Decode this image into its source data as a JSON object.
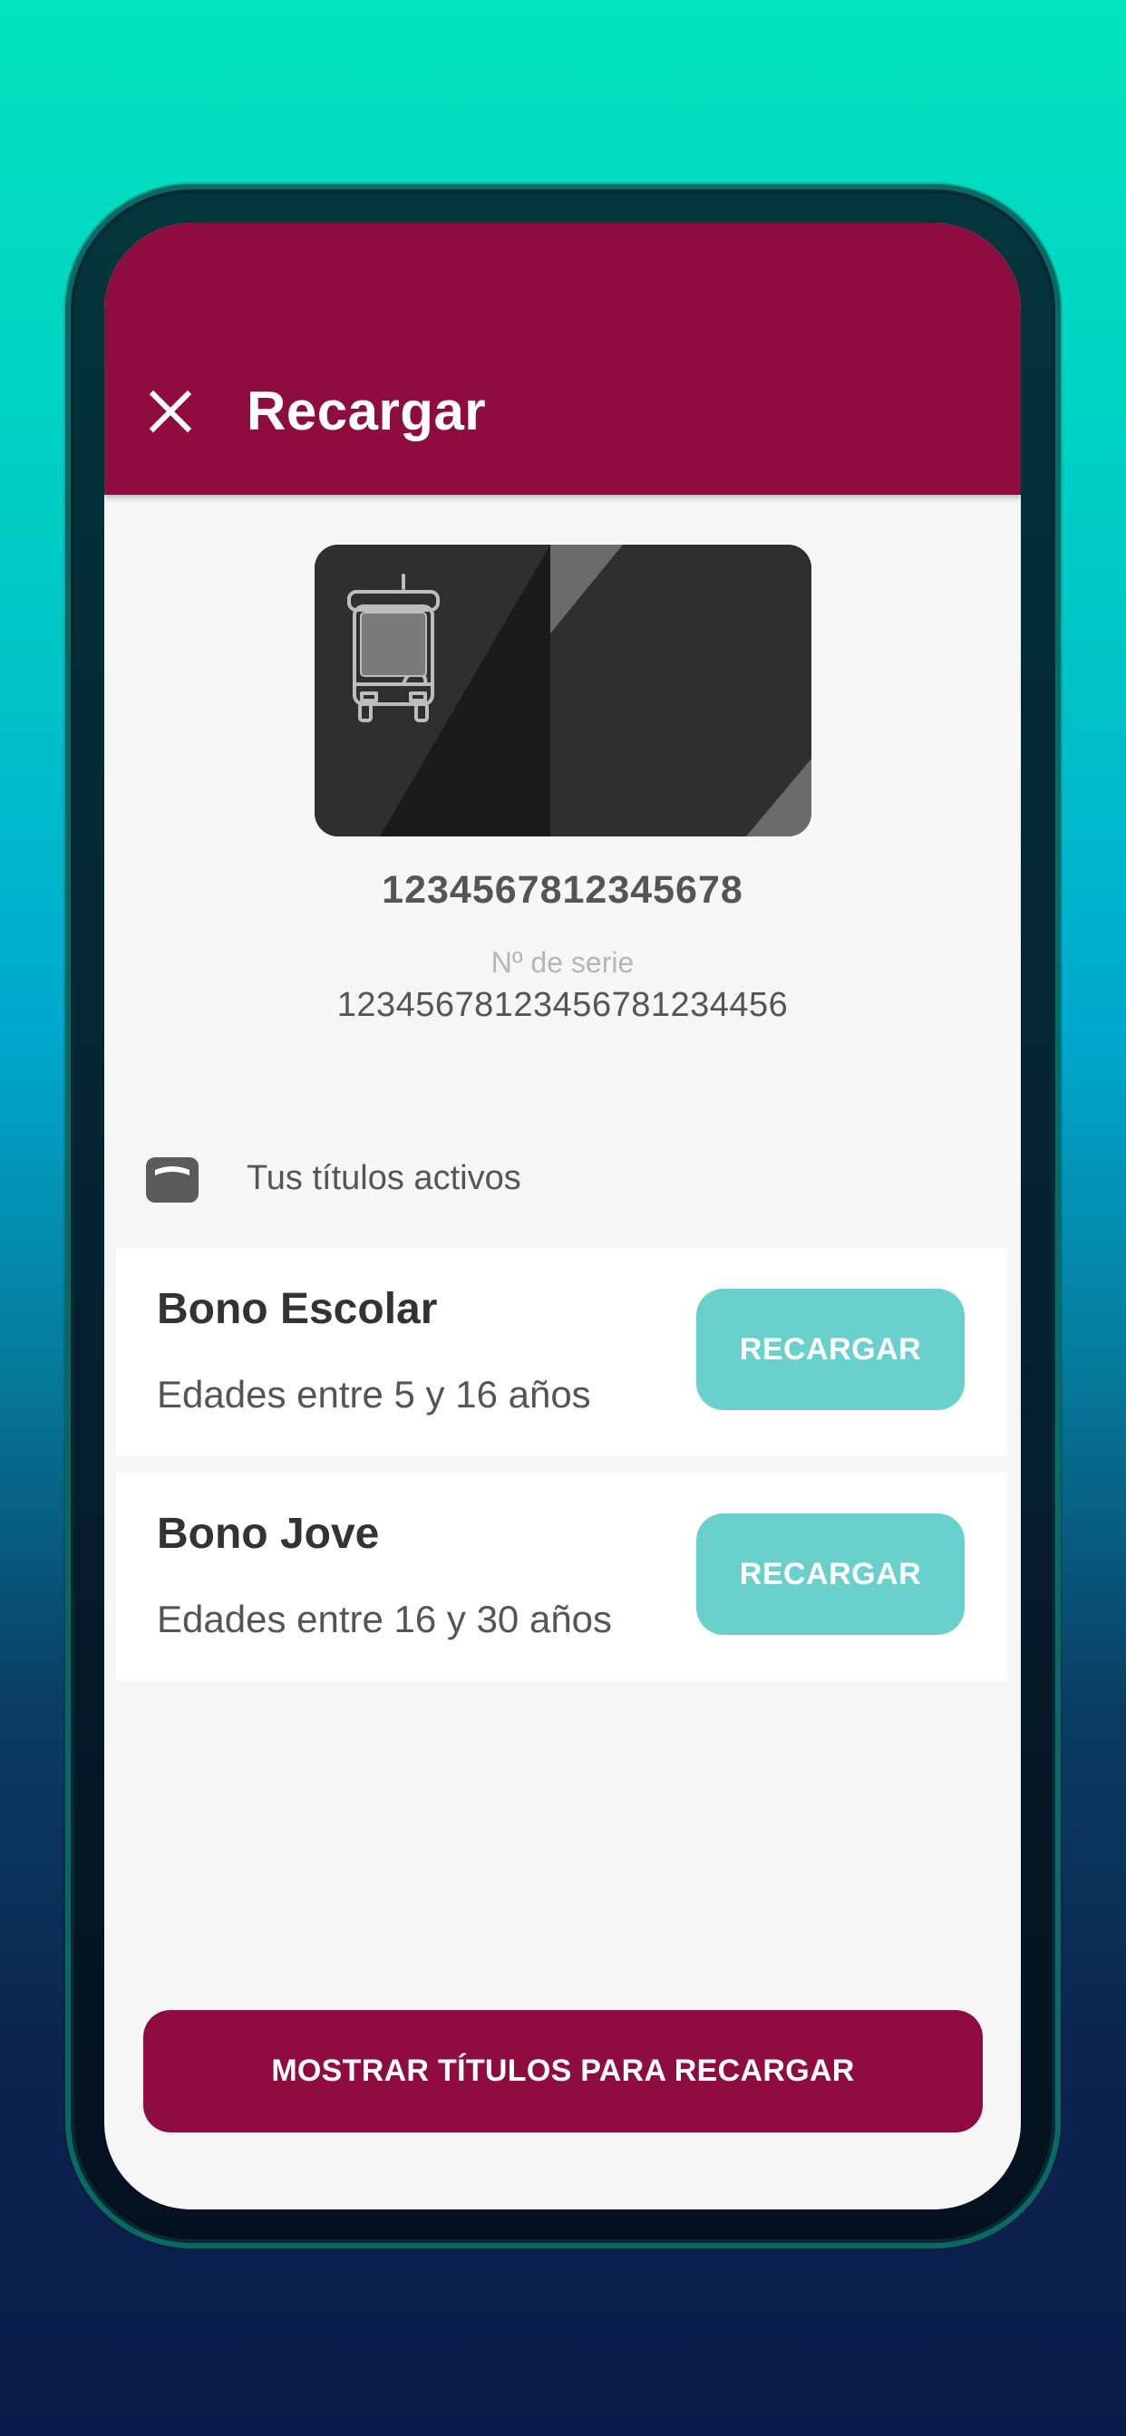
{
  "appbar": {
    "title": "Recargar",
    "close_icon": "close-icon",
    "color": "#8e0c3f"
  },
  "card": {
    "icon": "bus-icon",
    "number": "1234567812345678",
    "serial_label": "Nº de serie",
    "serial_value": "12345678123456781234456"
  },
  "active_passes": {
    "icon": "wallet-icon",
    "title": "Tus títulos activos",
    "items": [
      {
        "name": "Bono Escolar",
        "description": "Edades entre 5 y 16 años",
        "button_label": "RECARGAR"
      },
      {
        "name": "Bono Jove",
        "description": "Edades entre 16 y 30 años",
        "button_label": "RECARGAR"
      }
    ]
  },
  "footer": {
    "show_passes_label": "MOSTRAR TÍTULOS PARA RECARGAR"
  },
  "colors": {
    "primary": "#8e0c3f",
    "accent": "#6ad0cc",
    "background": "#f6f6f6"
  }
}
